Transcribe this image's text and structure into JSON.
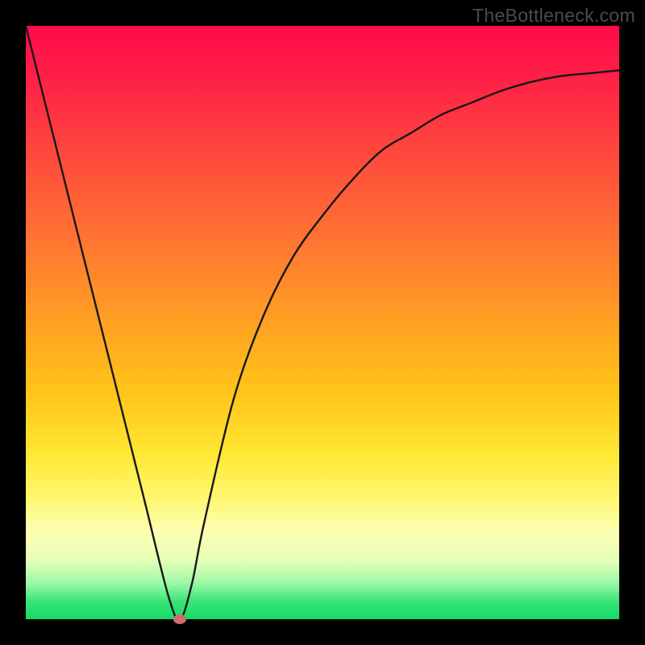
{
  "watermark": "TheBottleneck.com",
  "colors": {
    "frame": "#000000",
    "gradient_top": "#ff0a4a",
    "gradient_bottom": "#14d96a",
    "curve": "#171717",
    "marker": "#d46a6e"
  },
  "chart_data": {
    "type": "line",
    "title": "",
    "xlabel": "",
    "ylabel": "",
    "x": [
      0.0,
      0.05,
      0.1,
      0.15,
      0.2,
      0.24,
      0.26,
      0.28,
      0.3,
      0.35,
      0.4,
      0.45,
      0.5,
      0.55,
      0.6,
      0.65,
      0.7,
      0.75,
      0.8,
      0.85,
      0.9,
      0.95,
      1.0
    ],
    "values": [
      1.0,
      0.8,
      0.6,
      0.4,
      0.2,
      0.04,
      0.0,
      0.06,
      0.16,
      0.37,
      0.51,
      0.61,
      0.68,
      0.74,
      0.79,
      0.82,
      0.85,
      0.87,
      0.89,
      0.905,
      0.915,
      0.92,
      0.925
    ],
    "xlim": [
      0,
      1
    ],
    "ylim": [
      0,
      1
    ],
    "marker": {
      "x": 0.26,
      "y": 0.0
    },
    "annotations": []
  }
}
